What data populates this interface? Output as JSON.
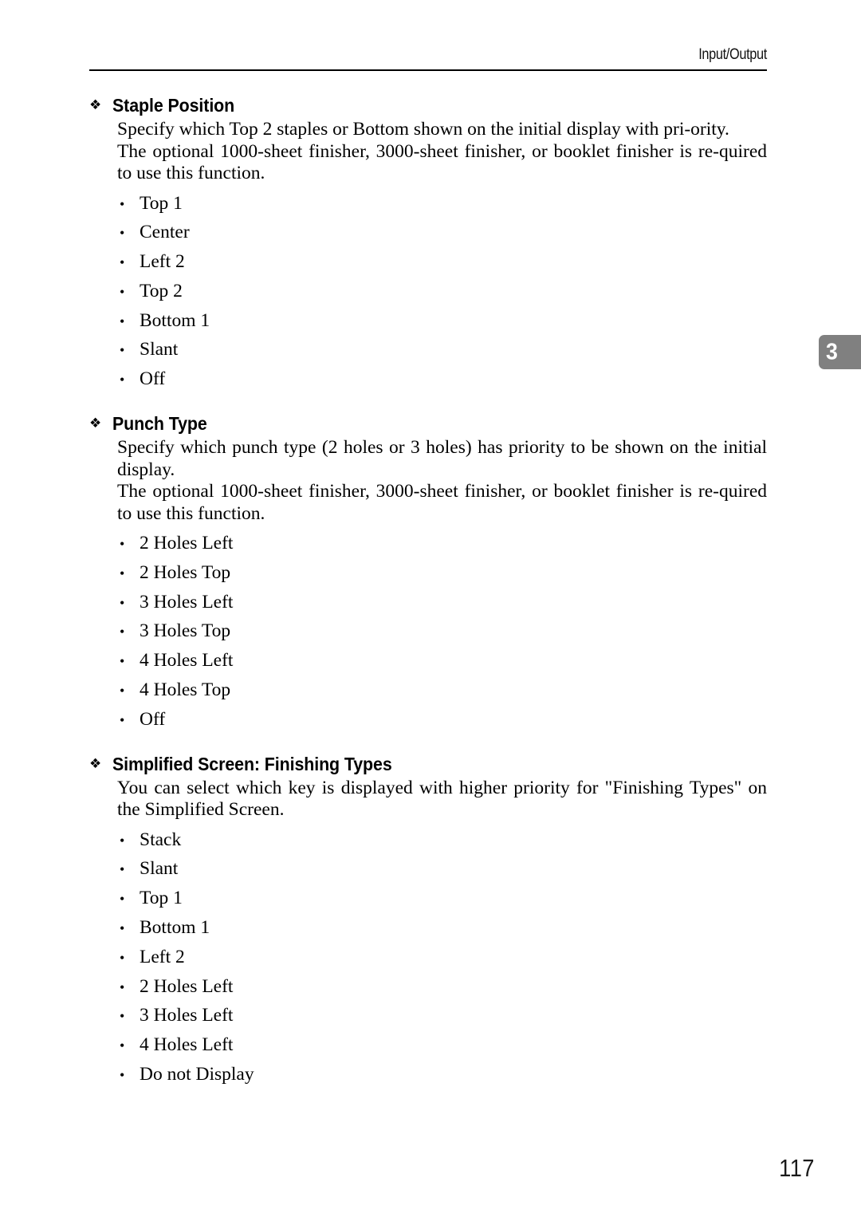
{
  "document": {
    "running_header": "Input/Output",
    "page_number": "117",
    "chapter_tab": {
      "number": "3",
      "color": "#808080",
      "text_color": "#ffffff"
    },
    "heading_bullet_glyph": "❖",
    "list_bullet_glyph": "•"
  },
  "sections": [
    {
      "heading": "Staple Position",
      "paragraphs": [
        "Specify which Top 2 staples or Bottom shown on the initial display with pri-ority.",
        "The optional 1000-sheet finisher, 3000-sheet finisher, or booklet finisher is re-quired to use this function."
      ],
      "options": [
        "Top 1",
        "Center",
        "Left 2",
        "Top 2",
        "Bottom 1",
        "Slant",
        "Off"
      ]
    },
    {
      "heading": "Punch Type",
      "paragraphs": [
        "Specify which punch type (2 holes or 3 holes) has priority to be shown on the initial display.",
        "The optional 1000-sheet finisher, 3000-sheet finisher, or booklet finisher is re-quired to use this function."
      ],
      "options": [
        "2 Holes Left",
        "2 Holes Top",
        "3 Holes Left",
        "3 Holes Top",
        "4 Holes Left",
        "4 Holes Top",
        "Off"
      ]
    },
    {
      "heading": "Simplified Screen: Finishing Types",
      "paragraphs": [
        "You can select which key is displayed with higher priority for \"Finishing Types\" on the Simplified Screen."
      ],
      "options": [
        "Stack",
        "Slant",
        "Top 1",
        "Bottom 1",
        "Left 2",
        "2 Holes Left",
        "3 Holes Left",
        "4 Holes Left",
        "Do not Display"
      ]
    }
  ]
}
